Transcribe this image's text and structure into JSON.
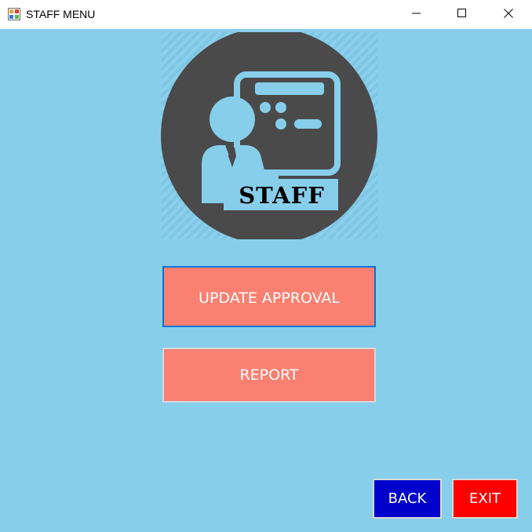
{
  "window": {
    "title": "STAFF MENU",
    "controls": {
      "minimize_icon": "minimize-icon",
      "maximize_icon": "maximize-icon",
      "close_icon": "close-icon"
    }
  },
  "logo": {
    "icon": "staff-presenter-icon",
    "text": "STAFF"
  },
  "menu": {
    "update_approval_label": "UPDATE APPROVAL",
    "report_label": "REPORT"
  },
  "footer": {
    "back_label": "BACK",
    "exit_label": "EXIT"
  },
  "colors": {
    "background": "#87ceeb",
    "menu_button": "#fa8072",
    "back_button": "#0000cd",
    "exit_button": "#ff0000",
    "logo_circle": "#4a4a4a",
    "focus_border": "#0078d7"
  }
}
